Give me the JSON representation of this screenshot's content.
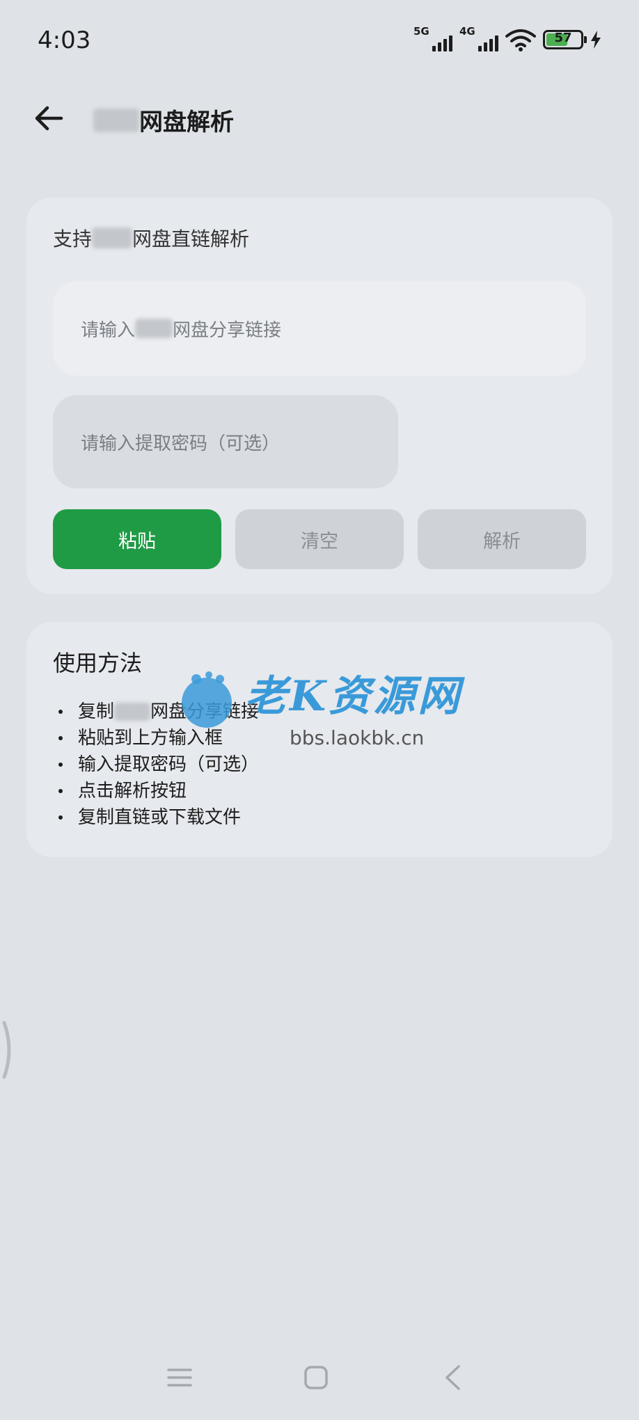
{
  "status_bar": {
    "time": "4:03",
    "signal1_label": "5G",
    "signal2_label": "4G",
    "battery_level": "57"
  },
  "header": {
    "title_suffix": "网盘解析"
  },
  "main_card": {
    "subtitle_prefix": "支持",
    "subtitle_suffix": "网盘直链解析",
    "link_placeholder_prefix": "请输入",
    "link_placeholder_suffix": "网盘分享链接",
    "password_placeholder": "请输入提取密码（可选）",
    "buttons": {
      "paste": "粘贴",
      "clear": "清空",
      "parse": "解析"
    }
  },
  "usage_card": {
    "title": "使用方法",
    "steps": [
      {
        "prefix": "复制",
        "suffix": "网盘分享链接"
      },
      {
        "prefix": "粘贴到上方输入框",
        "suffix": ""
      },
      {
        "prefix": "输入提取密码（可选）",
        "suffix": ""
      },
      {
        "prefix": "点击解析按钮",
        "suffix": ""
      },
      {
        "prefix": "复制直链或下载文件",
        "suffix": ""
      }
    ]
  },
  "watermark": {
    "brand": "老K资源网",
    "url": "bbs.laokbk.cn"
  },
  "colors": {
    "background": "#dfe3e7",
    "card": "#e6e9ed",
    "primary_button": "#1f9b45",
    "disabled_button": "#cfd3d7",
    "battery_fill": "#4caf50"
  },
  "icons": {
    "back": "arrow-left-icon",
    "wifi": "wifi-icon",
    "charging": "lightning-icon",
    "nav_menu": "menu-icon",
    "nav_home": "square-icon",
    "nav_back": "chevron-left-icon"
  }
}
